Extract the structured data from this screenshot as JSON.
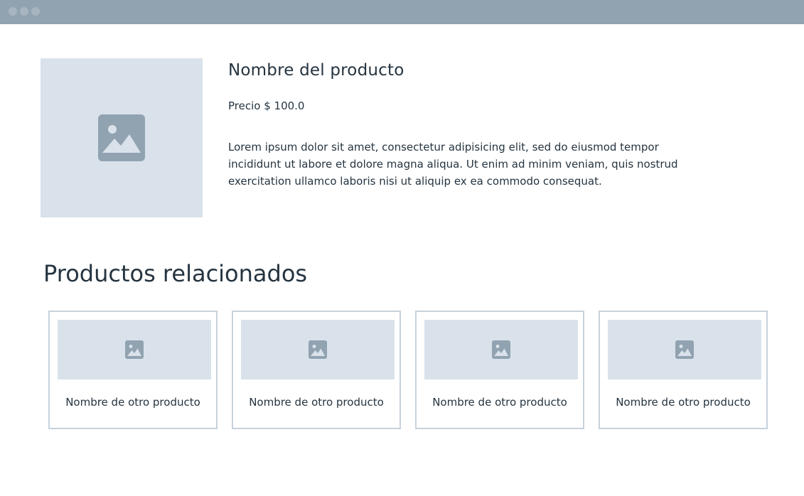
{
  "colors": {
    "window_bar": "#91a2b0",
    "placeholder_bg": "#d9e2ea",
    "placeholder_icon": "#91a2b0",
    "text": "#253440",
    "card_border": "#c6d2dc"
  },
  "window": {
    "controls": [
      "dot",
      "dot",
      "dot"
    ]
  },
  "product": {
    "image_icon": "image-icon",
    "title": "Nombre del producto",
    "price": "Precio $ 100.0",
    "description": "Lorem ipsum dolor sit amet, consectetur adipisicing elit, sed do eiusmod tempor incididunt ut labore et dolore magna aliqua. Ut enim ad minim veniam, quis nostrud exercitation ullamco laboris nisi ut aliquip ex ea commodo consequat."
  },
  "related": {
    "title": "Productos relacionados",
    "items": [
      {
        "label": "Nombre de otro producto",
        "icon": "image-icon"
      },
      {
        "label": "Nombre de otro producto",
        "icon": "image-icon"
      },
      {
        "label": "Nombre de otro producto",
        "icon": "image-icon"
      },
      {
        "label": "Nombre de otro producto",
        "icon": "image-icon"
      }
    ]
  }
}
